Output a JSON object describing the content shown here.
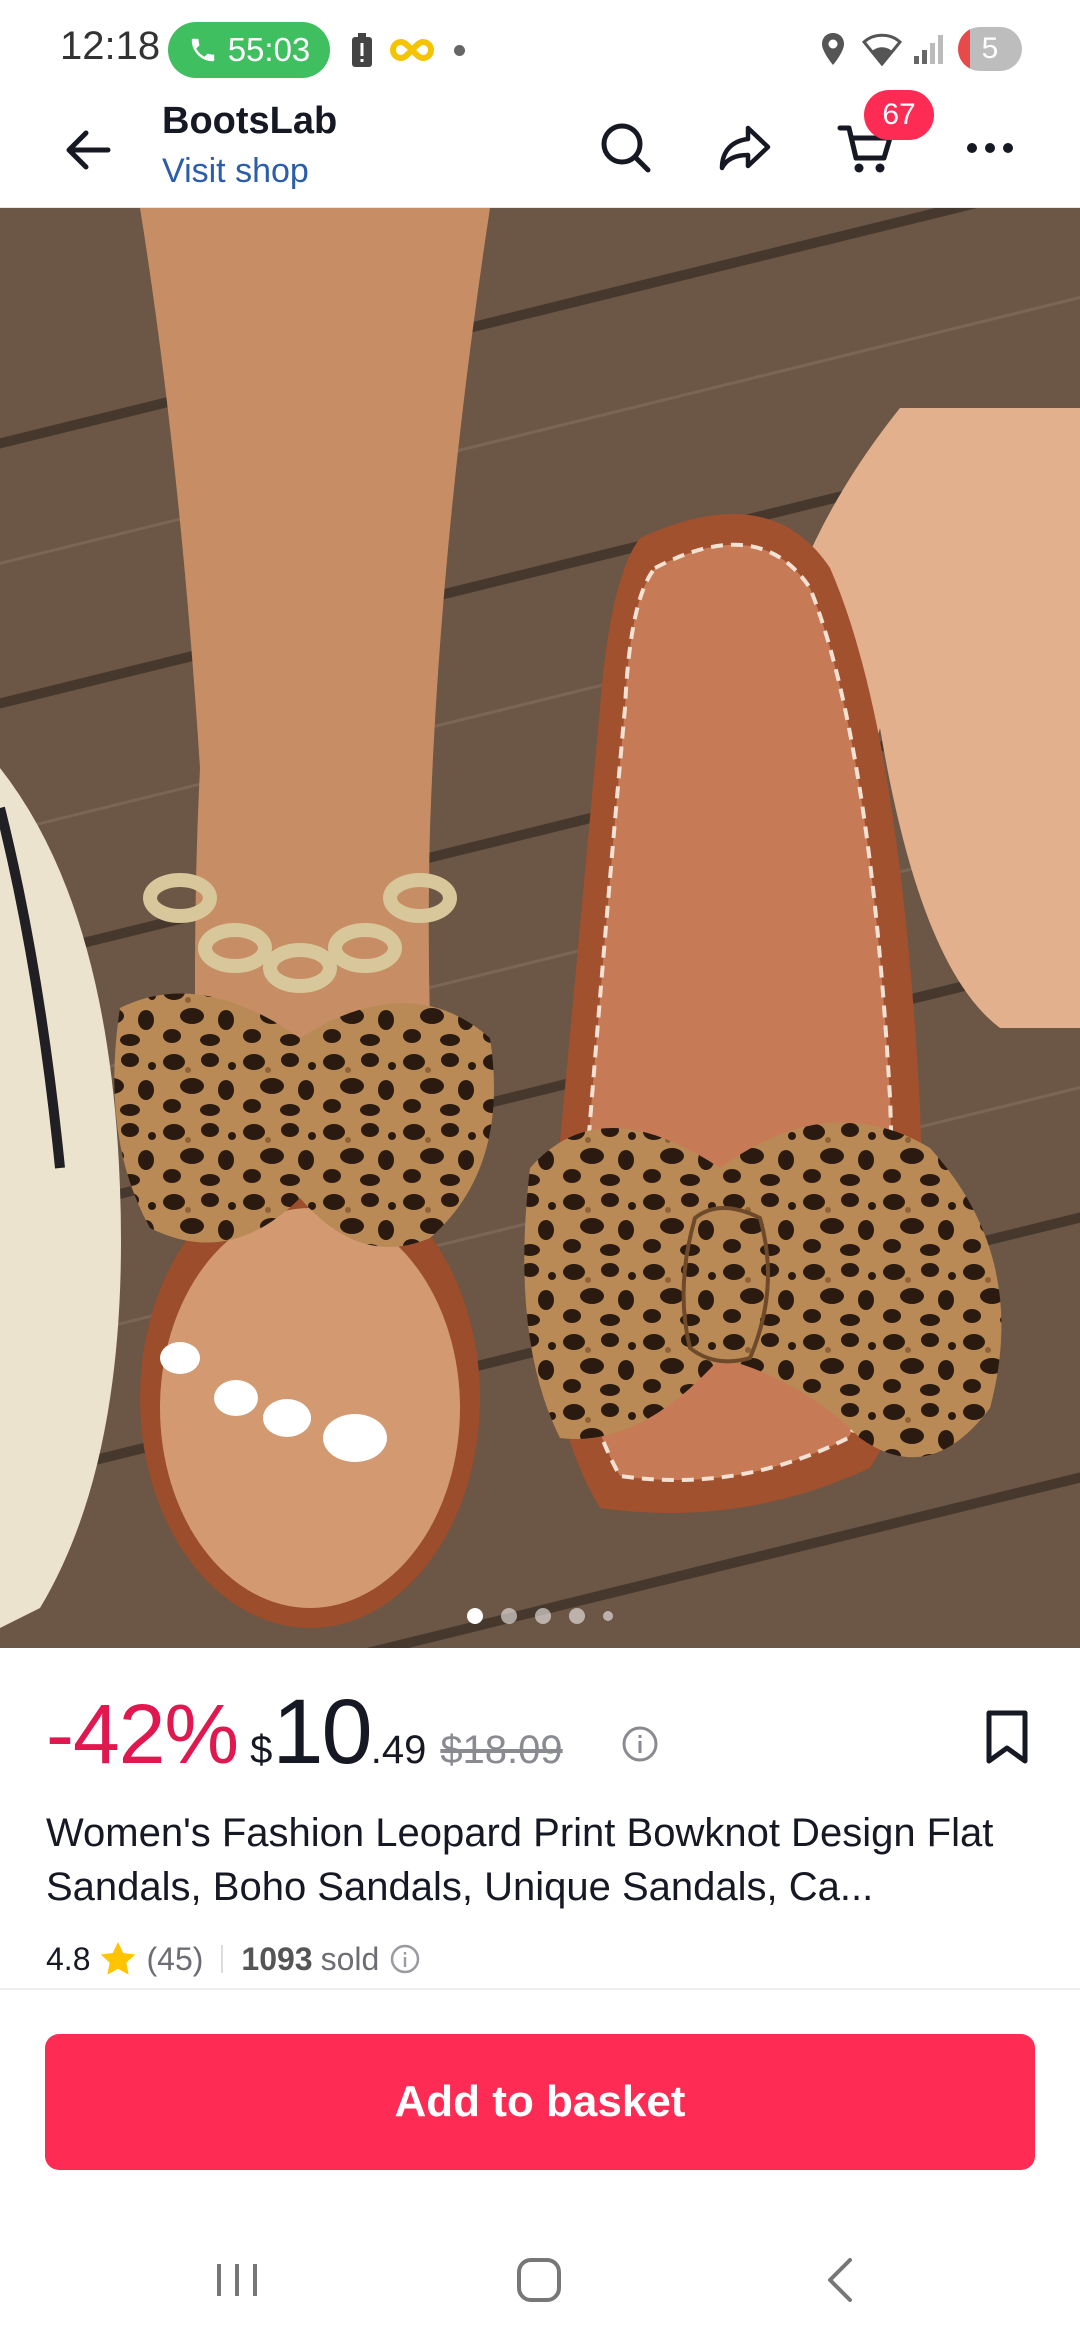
{
  "status_bar": {
    "time": "12:18",
    "call_timer": "55:03",
    "battery_level": "5",
    "icons": [
      "phone-icon",
      "battery-alert-icon",
      "infinity-icon",
      "location-icon",
      "wifi-icon",
      "signal-icon",
      "battery-icon"
    ]
  },
  "header": {
    "shop_name": "BootsLab",
    "visit_shop": "Visit shop",
    "cart_count": "67",
    "icons": [
      "back-arrow-icon",
      "search-icon",
      "share-icon",
      "cart-icon",
      "more-icon"
    ]
  },
  "product": {
    "image_alt": "leopard print bowknot flat sandals",
    "carousel": {
      "total": 5,
      "active": 1
    },
    "discount": "-42%",
    "currency": "$",
    "price_int": "10",
    "price_dec": ".49",
    "original_price": "$18.09",
    "title": "Women's Fashion Leopard Print Bowknot Design Flat Sandals, Boho Sandals, Unique Sandals, Ca...",
    "rating": "4.8",
    "reviews": "(45)",
    "sold_count": "1093",
    "sold_label": "sold"
  },
  "cta": {
    "add_to_basket": "Add to basket"
  },
  "colors": {
    "accent": "#fe2c55",
    "discount": "#e0184f",
    "link": "#2b5dab",
    "call_pill": "#3fbf5f",
    "star": "#ffc300"
  }
}
